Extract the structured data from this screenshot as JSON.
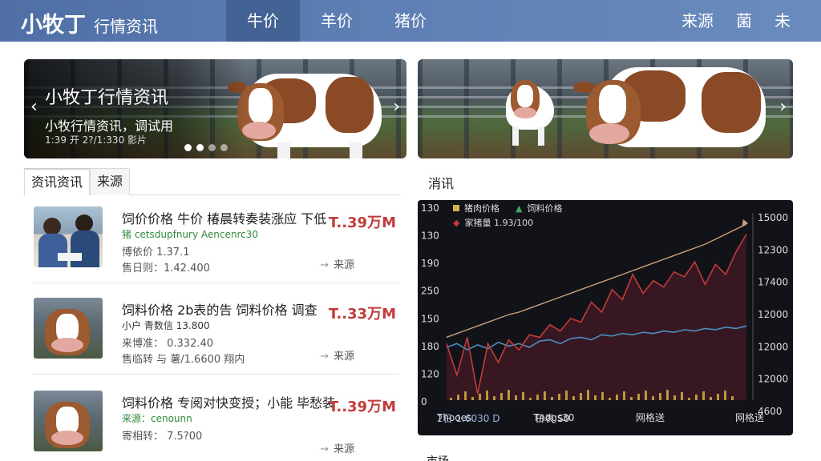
{
  "header": {
    "brand_main": "小牧丁",
    "brand_sub": "行情资讯",
    "tabs": [
      "牛价",
      "羊价",
      "猪价"
    ],
    "right_links": [
      "来源",
      "菌",
      "未"
    ]
  },
  "banners": [
    {
      "title": "小牧丁行情资讯",
      "subtitle": "小牧行情资讯，调试用",
      "meta": "1:39 开 2?/1:330 影片",
      "prev": "‹",
      "next": "›"
    },
    {
      "next": "›"
    }
  ],
  "left_tabs": [
    "资讯资讯",
    "来源"
  ],
  "news": [
    {
      "title": "饲价价格 牛价 椿晨转奏装涨应 下低",
      "price": "T..39万M",
      "line2": "猪 cetsdupfnury Aencenrc30",
      "line3": "博依价 1.37.1",
      "line4": "售日则：1.42.400",
      "source": "来源"
    },
    {
      "title": "饲料价格 2b表的告 饲料价格 调查",
      "price": "T..33万M",
      "line2": "小户 青数信 13.800",
      "line3": "来博准： 0.332.40",
      "line4": "售临转 与 薯/1.6600 翔内",
      "source": "来源"
    },
    {
      "title": "饲料价格 专阅对快变授；小能 毕愁装",
      "price": "T..39万M",
      "line2": "来源：cenounn",
      "line3": "寄相转： 7.5?00",
      "line4": "",
      "source": "来源"
    }
  ],
  "right_section_title": "消讯",
  "bottom_cut_title": "市场",
  "chart_data": {
    "type": "line",
    "title": "",
    "legend": [
      {
        "name": "猪肉价格",
        "color": "#d6b04b"
      },
      {
        "name": "饲料价格",
        "color": "#4a90c2"
      },
      {
        "name": "家猪量  1.93/100",
        "color": "#c23b3b"
      }
    ],
    "left_axis_ticks": [
      "130",
      "130",
      "190",
      "250",
      "150",
      "180",
      "120",
      "0"
    ],
    "right_axis_ticks": [
      "15000",
      "12300",
      "17400",
      "12000",
      "12000",
      "12000",
      "4600"
    ],
    "x_tick_labels": [
      "Thooes",
      "Tnogs30",
      "网格送",
      "网格送"
    ],
    "x_tick_sublabels": [
      "2日 1.6030 D",
      "",
      "日表 S0",
      ""
    ],
    "grid": false,
    "series": [
      {
        "name": "猪肉价格",
        "color": "#c8a07a",
        "values": [
          0.1,
          0.13,
          0.16,
          0.19,
          0.22,
          0.25,
          0.28,
          0.3,
          0.33,
          0.36,
          0.39,
          0.42,
          0.45,
          0.48,
          0.51,
          0.54,
          0.57,
          0.6,
          0.63,
          0.66,
          0.69,
          0.72,
          0.75,
          0.78,
          0.81,
          0.84,
          0.88,
          0.92,
          0.96,
          1.0
        ]
      },
      {
        "name": "饲料价格",
        "color": "#4a90c2",
        "values": [
          0.02,
          0.05,
          0.0,
          0.04,
          0.01,
          0.06,
          0.03,
          0.05,
          0.02,
          0.07,
          0.08,
          0.05,
          0.09,
          0.1,
          0.08,
          0.12,
          0.11,
          0.13,
          0.12,
          0.14,
          0.13,
          0.15,
          0.14,
          0.16,
          0.15,
          0.17,
          0.16,
          0.18,
          0.17,
          0.19
        ]
      },
      {
        "name": "家猪量",
        "color": "#c23b3b",
        "values": [
          0.05,
          -0.2,
          0.1,
          -0.35,
          0.05,
          -0.1,
          0.08,
          0.0,
          0.12,
          0.1,
          0.2,
          0.15,
          0.25,
          0.22,
          0.38,
          0.3,
          0.48,
          0.4,
          0.6,
          0.45,
          0.55,
          0.5,
          0.62,
          0.58,
          0.7,
          0.52,
          0.68,
          0.6,
          0.78,
          0.92
        ]
      }
    ]
  }
}
